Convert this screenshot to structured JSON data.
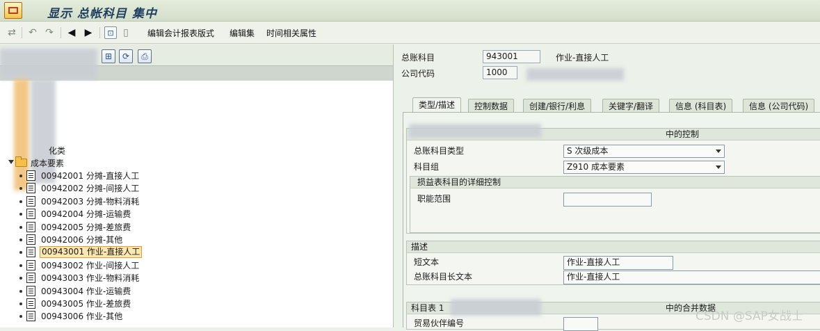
{
  "window": {
    "title": "显示 总帐科目 集中"
  },
  "toolbar": {
    "links": [
      "编辑会计报表版式",
      "编辑集",
      "时间相关属性"
    ]
  },
  "tree": {
    "partial_label": "化类",
    "folder_label": "成本要素",
    "items": [
      {
        "code": "00942001",
        "name": "分摊-直接人工"
      },
      {
        "code": "00942002",
        "name": "分摊-间接人工"
      },
      {
        "code": "00942003",
        "name": "分摊-物料消耗"
      },
      {
        "code": "00942004",
        "name": "分摊-运输费"
      },
      {
        "code": "00942005",
        "name": "分摊-差旅费"
      },
      {
        "code": "00942006",
        "name": "分摊-其他"
      },
      {
        "code": "00943001",
        "name": "作业-直接人工",
        "selected": true
      },
      {
        "code": "00943002",
        "name": "作业-间接人工"
      },
      {
        "code": "00943003",
        "name": "作业-物料消耗"
      },
      {
        "code": "00943004",
        "name": "作业-运输费"
      },
      {
        "code": "00943005",
        "name": "作业-差旅费"
      },
      {
        "code": "00943006",
        "name": "作业-其他"
      }
    ]
  },
  "header": {
    "account_label": "总账科目",
    "account_value": "943001",
    "account_desc": "作业-直接人工",
    "company_label": "公司代码",
    "company_value": "1000"
  },
  "tabs": [
    "类型/描述",
    "控制数据",
    "创建/银行/利息",
    "关键字/翻译",
    "信息 (科目表)",
    "信息 (公司代码)"
  ],
  "active_tab": "类型/描述",
  "control_group": {
    "heading_suffix": "中的控制",
    "type_label": "总账科目类型",
    "type_value": "S 次级成本",
    "group_label": "科目组",
    "group_value": "Z910 成本要素",
    "pl_heading": "损益表科目的详细控制",
    "func_label": "职能范围",
    "func_value": ""
  },
  "description_group": {
    "heading": "描述",
    "short_label": "短文本",
    "short_value": "作业-直接人工",
    "long_label": "总账科目长文本",
    "long_value": "作业-直接人工"
  },
  "consol_group": {
    "heading_prefix": "科目表 1",
    "heading_suffix": "中的合并数据",
    "partner_label": "贸易伙伴编号"
  },
  "watermark": "CSDN @SAP女战士"
}
